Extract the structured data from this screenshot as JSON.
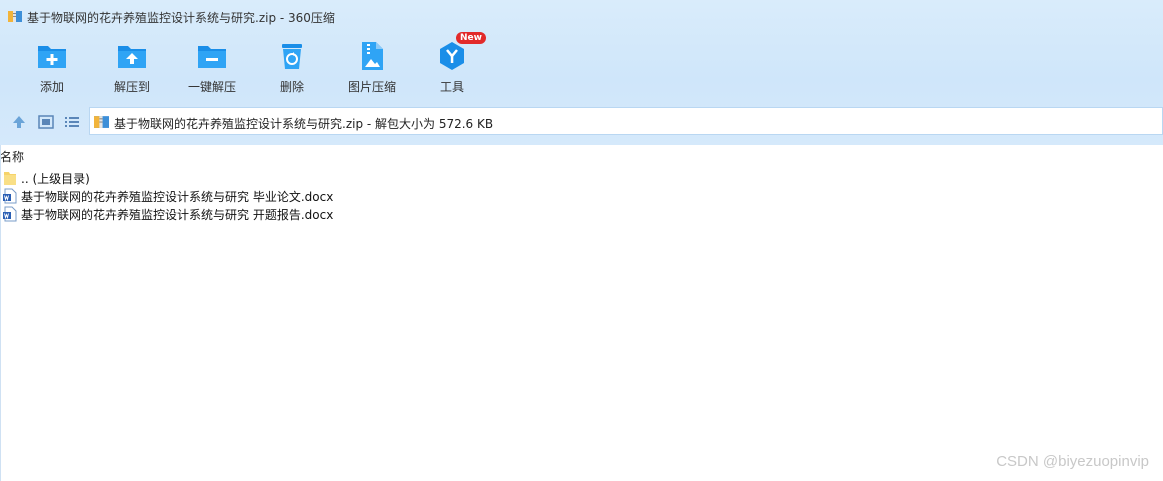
{
  "window": {
    "title": "基于物联网的花卉养殖监控设计系统与研究.zip - 360压缩"
  },
  "toolbar": {
    "items": [
      {
        "label": "添加",
        "icon": "add-folder-icon"
      },
      {
        "label": "解压到",
        "icon": "extract-to-icon"
      },
      {
        "label": "一键解压",
        "icon": "one-click-extract-icon"
      },
      {
        "label": "删除",
        "icon": "delete-icon"
      },
      {
        "label": "图片压缩",
        "icon": "image-compress-icon"
      },
      {
        "label": "工具",
        "icon": "tools-icon",
        "badge": "New"
      }
    ]
  },
  "navbar": {
    "buttons": [
      "up-arrow-icon",
      "thumbnail-view-icon",
      "list-view-icon"
    ],
    "path_text": "基于物联网的花卉养殖监控设计系统与研究.zip - 解包大小为 572.6 KB"
  },
  "filelist": {
    "column_header": "名称",
    "rows": [
      {
        "name": ".. (上级目录)",
        "icon": "folder-icon"
      },
      {
        "name": "基于物联网的花卉养殖监控设计系统与研究 毕业论文.docx",
        "icon": "word-doc-icon"
      },
      {
        "name": "基于物联网的花卉养殖监控设计系统与研究 开题报告.docx",
        "icon": "word-doc-icon"
      }
    ]
  },
  "watermark": "CSDN @biyezuopinvip",
  "colors": {
    "accent": "#1a8ee8",
    "band": "#d5e9fb",
    "badge": "#e22a2a"
  }
}
